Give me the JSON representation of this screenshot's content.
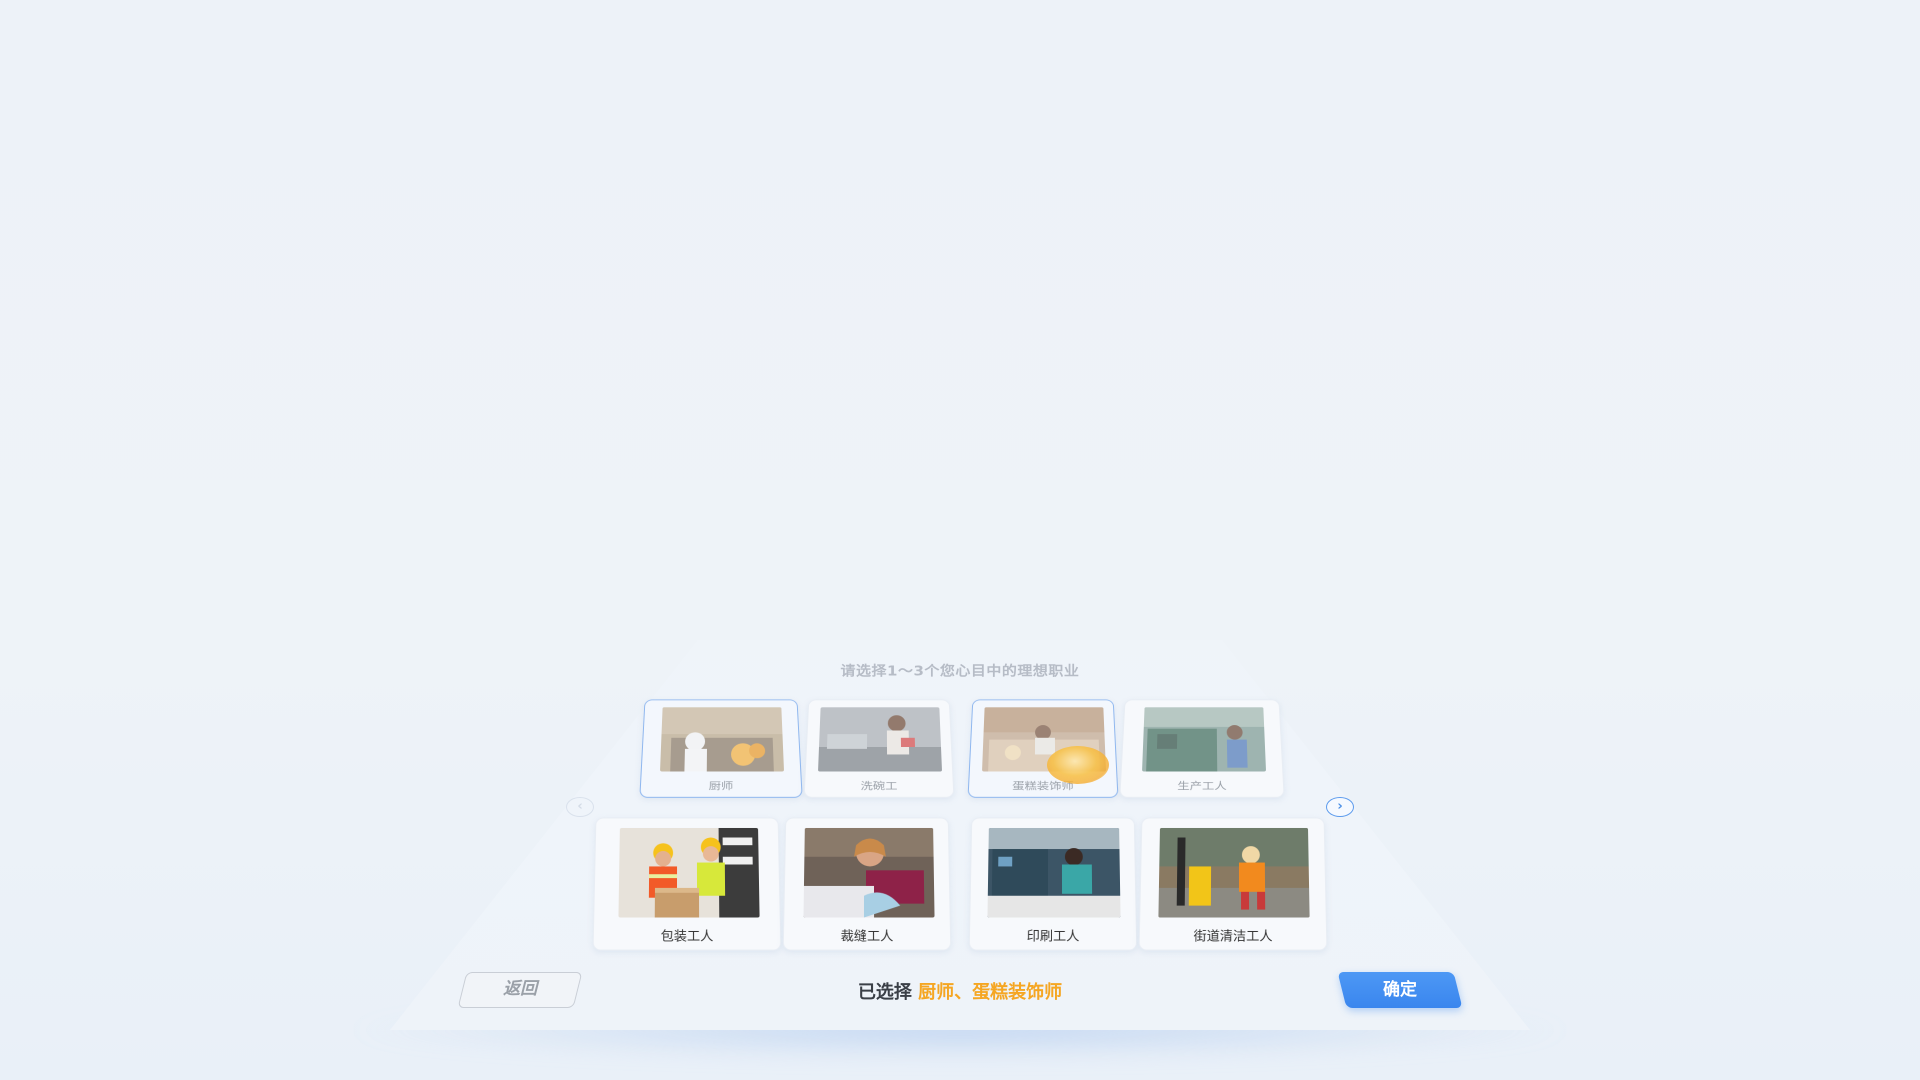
{
  "prompt": "请选择1～3个您心目中的理想职业",
  "jobs_row1": [
    {
      "label": "厨师",
      "selected": true
    },
    {
      "label": "洗碗工",
      "selected": false
    },
    {
      "label": "蛋糕装饰师",
      "selected": true
    },
    {
      "label": "生产工人",
      "selected": false
    }
  ],
  "jobs_row2": [
    {
      "label": "包装工人",
      "selected": false
    },
    {
      "label": "裁缝工人",
      "selected": false
    },
    {
      "label": "印刷工人",
      "selected": false
    },
    {
      "label": "街道清洁工人",
      "selected": false
    }
  ],
  "nav": {
    "prev_icon": "chevron-left-icon",
    "next_icon": "chevron-right-icon",
    "prev_glyph": "‹",
    "next_glyph": "›"
  },
  "footer": {
    "back_label": "返回",
    "selected_prefix": "已选择",
    "selected_value": "厨师、蛋糕装饰师",
    "confirm_label": "确定"
  },
  "colors": {
    "accent": "#3a86ee",
    "highlight": "#f5a623",
    "selected_border": "#8fb7ef"
  }
}
